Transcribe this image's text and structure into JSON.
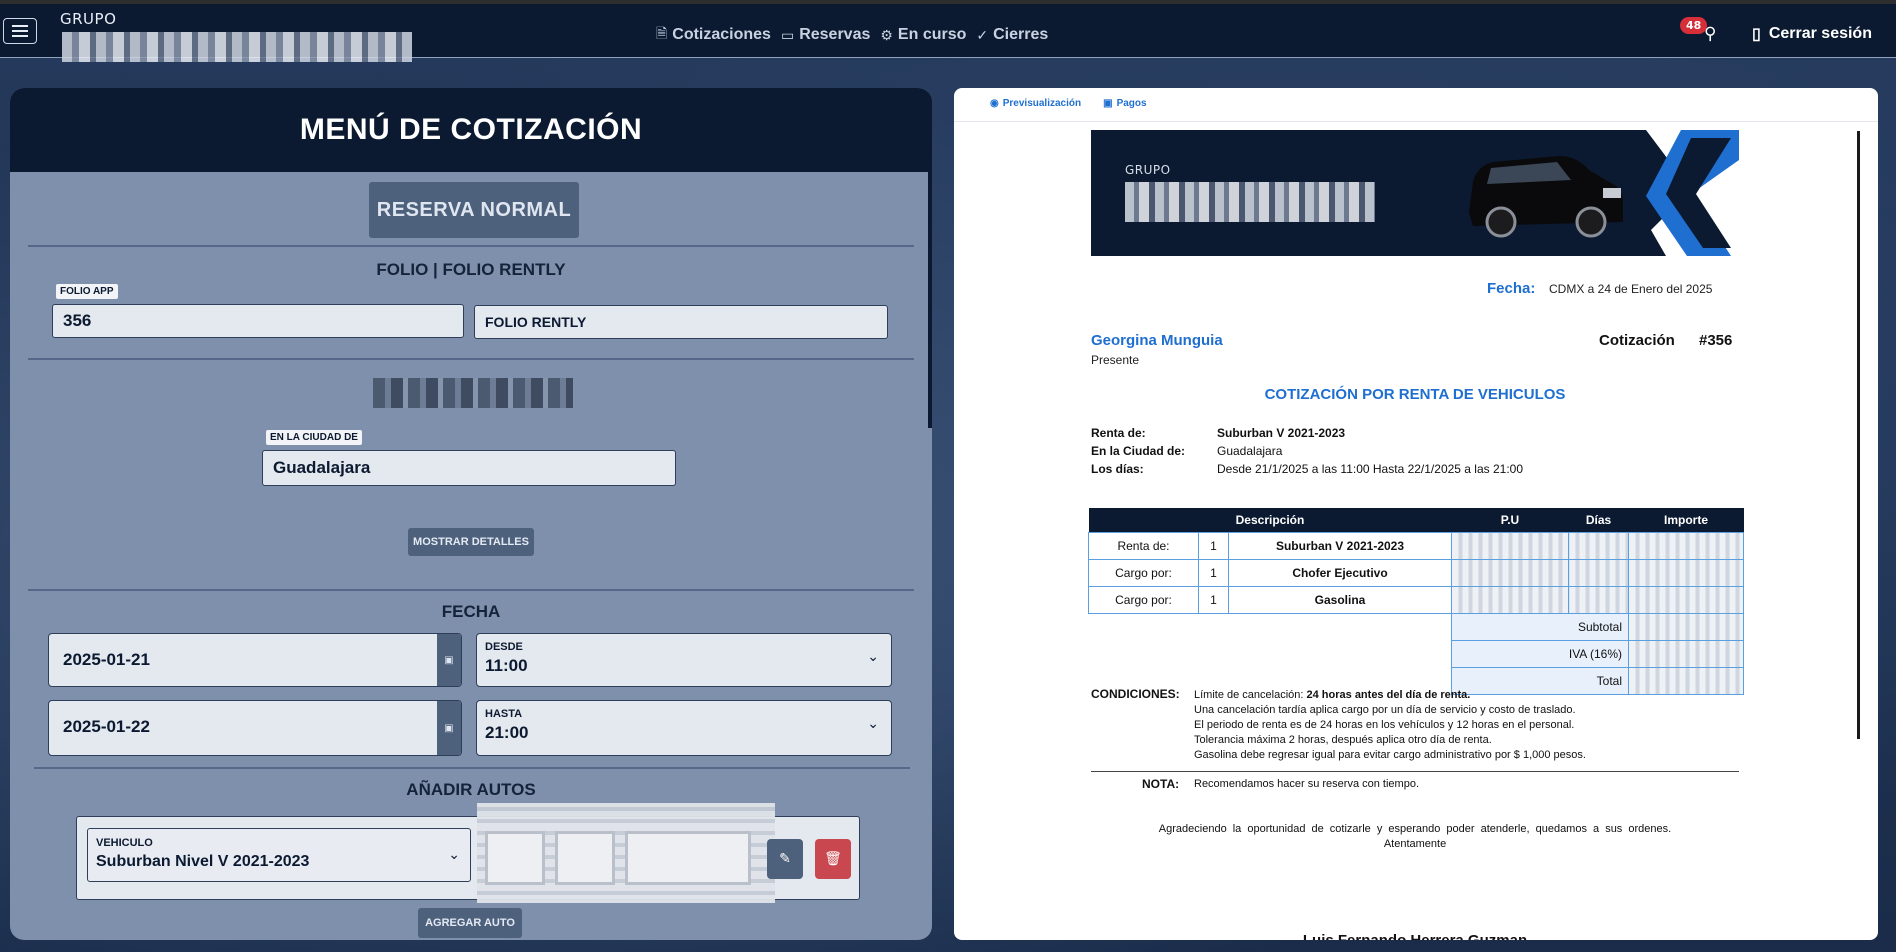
{
  "navbar": {
    "brand_small": "GRUPO",
    "links": [
      {
        "icon": "document-icon",
        "glyph": "🗎",
        "label": "Cotizaciones"
      },
      {
        "icon": "calendar-icon",
        "glyph": "▭",
        "label": "Reservas"
      },
      {
        "icon": "gear-icon",
        "glyph": "⚙",
        "label": "En curso"
      },
      {
        "icon": "check-circle-icon",
        "glyph": "✓",
        "label": "Cierres"
      }
    ],
    "notifications_count": "48",
    "logout_label": "Cerrar sesión"
  },
  "left": {
    "title": "MENÚ DE COTIZACIÓN",
    "reserva_button": "RESERVA NORMAL",
    "folio_section": "FOLIO | FOLIO RENTLY",
    "folio_app_label": "FOLIO APP",
    "folio_app_value": "356",
    "folio_rently_placeholder": "FOLIO RENTLY",
    "city_label": "EN LA CIUDAD DE",
    "city_value": "Guadalajara",
    "mostrar_detalles": "MOSTRAR DETALLES",
    "fecha_section": "FECHA",
    "date_start": "2025-01-21",
    "date_end": "2025-01-22",
    "desde_label": "DESDE",
    "desde_value": "11:00",
    "hasta_label": "HASTA",
    "hasta_value": "21:00",
    "autos_section": "AÑADIR AUTOS",
    "vehiculo_label": "VEHICULO",
    "vehiculo_value": "Suburban Nivel V 2021-2023",
    "agregar_auto": "AGREGAR AUTO"
  },
  "right": {
    "tabs": [
      {
        "icon": "eye-icon",
        "glyph": "◉",
        "label": "Previsualización"
      },
      {
        "icon": "money-icon",
        "glyph": "▣",
        "label": "Pagos"
      }
    ],
    "banner_small": "GRUPO",
    "fecha_label": "Fecha:",
    "fecha_value": "CDMX a 24 de Enero del 2025",
    "client_name": "Georgina Munguia",
    "presente": "Presente",
    "cotizacion_label": "Cotización",
    "cotizacion_number": "#356",
    "doc_title": "COTIZACIÓN POR RENTA DE VEHICULOS",
    "info": [
      {
        "k": "Renta de:",
        "v": "Suburban V 2021-2023",
        "bold": true
      },
      {
        "k": "En la Ciudad de:",
        "v": "Guadalajara",
        "bold": false
      },
      {
        "k": "Los días:",
        "v": "Desde 21/1/2025 a las 11:00 Hasta 22/1/2025 a las 21:00",
        "bold": false
      }
    ],
    "table": {
      "headers": [
        "Descripción",
        "P.U",
        "Días",
        "Importe"
      ],
      "rows": [
        {
          "label": "Renta de:",
          "qty": "1",
          "item": "Suburban V 2021-2023"
        },
        {
          "label": "Cargo por:",
          "qty": "1",
          "item": "Chofer Ejecutivo"
        },
        {
          "label": "Cargo por:",
          "qty": "1",
          "item": "Gasolina"
        }
      ],
      "totals": [
        "Subtotal",
        "IVA (16%)",
        "Total"
      ]
    },
    "condiciones_label": "CONDICIONES:",
    "condiciones_first_prefix": "Límite de cancelación:",
    "condiciones_first_bold": "24 horas antes del día de renta.",
    "condiciones": [
      "Una cancelación tardía aplica cargo por un día de servicio y costo de traslado.",
      "El periodo de renta es de 24 horas en los vehículos y 12 horas en el personal.",
      "Tolerancia máxima 2 horas, después aplica otro día de renta.",
      "Gasolina debe regresar igual para evitar cargo administrativo por $ 1,000 pesos."
    ],
    "nota_label": "NOTA:",
    "nota_value": "Recomendamos hacer su reserva con tiempo.",
    "thanks": "Agradeciendo la oportunidad de cotizarle y esperando poder atenderle, quedamos a sus ordenes.",
    "atentamente": "Atentamente",
    "signer": "Luis Fernando Herrera Guzman"
  }
}
